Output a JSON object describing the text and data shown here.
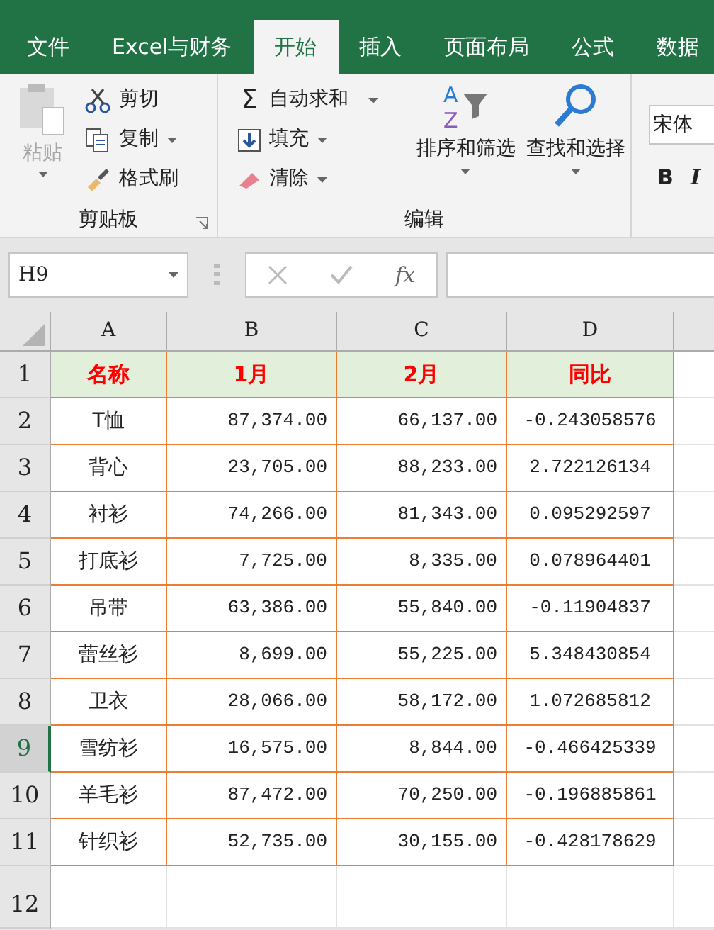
{
  "tabs": [
    {
      "label": "文件",
      "selected": false
    },
    {
      "label": "Excel与财务",
      "selected": false
    },
    {
      "label": "开始",
      "selected": true
    },
    {
      "label": "插入",
      "selected": false
    },
    {
      "label": "页面布局",
      "selected": false
    },
    {
      "label": "公式",
      "selected": false
    },
    {
      "label": "数据",
      "selected": false
    }
  ],
  "ribbon": {
    "clipboard": {
      "paste": {
        "label": "粘贴",
        "disabled": true
      },
      "cut": "剪切",
      "copy": "复制",
      "format_painter": "格式刷",
      "group_label": "剪贴板"
    },
    "editing": {
      "autosum_icon": "Σ",
      "autosum": "自动求和",
      "sort_icon_letters": [
        "A",
        "Z"
      ],
      "fill": "填充",
      "clear": "清除",
      "sort_filter": "排序和筛选",
      "find_select": "查找和选择",
      "group_label": "编辑"
    },
    "font": {
      "font_name": "宋体",
      "bold": "B",
      "italic": "I"
    }
  },
  "formula_bar": {
    "name_box": "H9",
    "fx": "fx"
  },
  "columns": [
    "A",
    "B",
    "C",
    "D"
  ],
  "header_row": [
    "名称",
    "1月",
    "2月",
    "同比"
  ],
  "rows": [
    {
      "number": "1",
      "selected": false
    },
    {
      "number": "2",
      "selected": false
    },
    {
      "number": "3",
      "selected": false
    },
    {
      "number": "4",
      "selected": false
    },
    {
      "number": "5",
      "selected": false
    },
    {
      "number": "6",
      "selected": false
    },
    {
      "number": "7",
      "selected": false
    },
    {
      "number": "8",
      "selected": false
    },
    {
      "number": "9",
      "selected": true
    },
    {
      "number": "10",
      "selected": false
    },
    {
      "number": "11",
      "selected": false
    },
    {
      "number": "12",
      "selected": false
    }
  ],
  "data": [
    [
      "T恤",
      "87,374.00",
      "66,137.00",
      "-0.243058576"
    ],
    [
      "背心",
      "23,705.00",
      "88,233.00",
      "2.722126134"
    ],
    [
      "衬衫",
      "74,266.00",
      "81,343.00",
      "0.095292597"
    ],
    [
      "打底衫",
      "7,725.00",
      "8,335.00",
      "0.078964401"
    ],
    [
      "吊带",
      "63,386.00",
      "55,840.00",
      "-0.11904837"
    ],
    [
      "蕾丝衫",
      "8,699.00",
      "55,225.00",
      "5.348430854"
    ],
    [
      "卫衣",
      "28,066.00",
      "58,172.00",
      "1.072685812"
    ],
    [
      "雪纺衫",
      "16,575.00",
      "8,844.00",
      "-0.466425339"
    ],
    [
      "羊毛衫",
      "87,472.00",
      "70,250.00",
      "-0.196885861"
    ],
    [
      "针织衫",
      "52,735.00",
      "30,155.00",
      "-0.428178629"
    ]
  ]
}
